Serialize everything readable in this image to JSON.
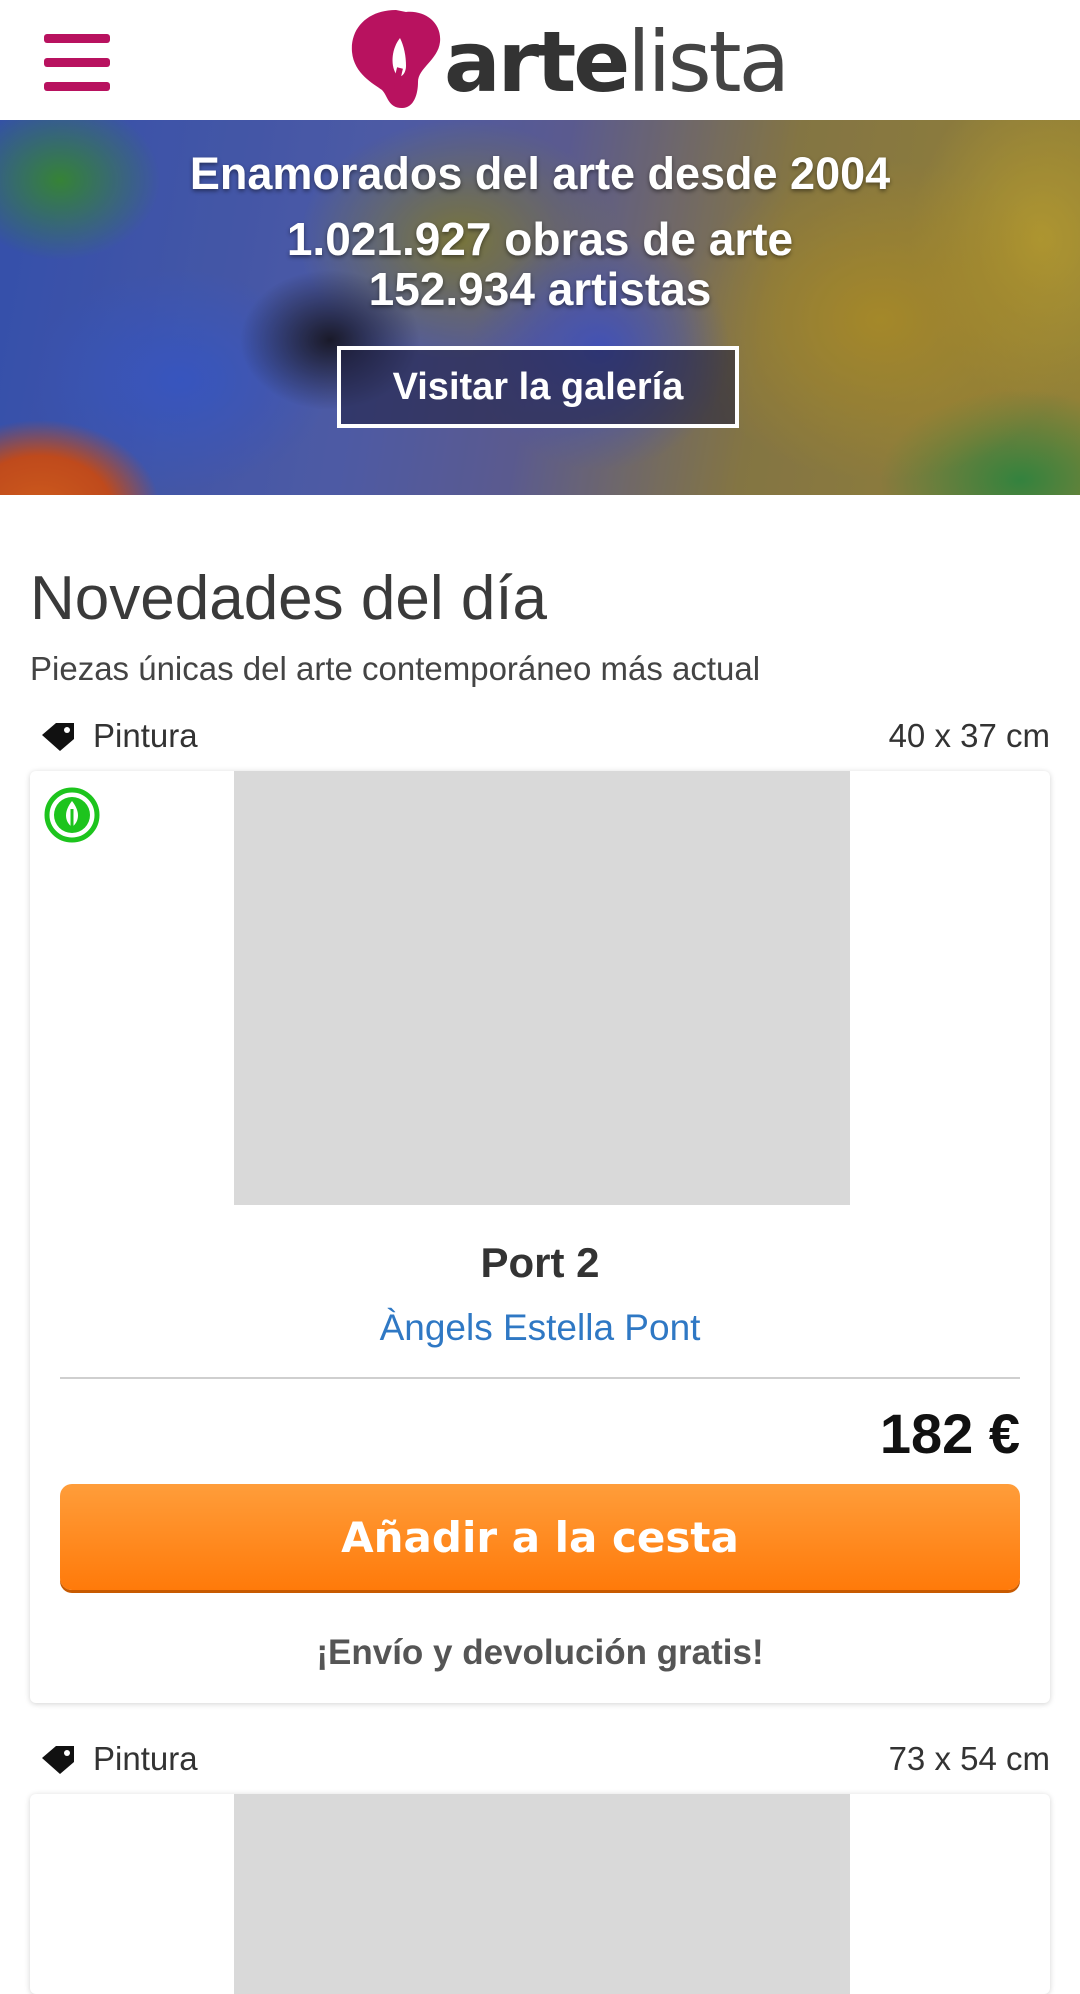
{
  "header": {
    "logo_text_bold": "arte",
    "logo_text_light": "lista",
    "logo_color": "#b8125f"
  },
  "hero": {
    "title": "Enamorados del arte desde 2004",
    "artworks": "1.021.927 obras de arte",
    "artists": "152.934 artistas",
    "button_label": "Visitar la galería"
  },
  "section": {
    "title": "Novedades del día",
    "subtitle": "Piezas únicas del arte contemporáneo más actual"
  },
  "products": [
    {
      "category": "Pintura",
      "size": "40 x 37 cm",
      "title": "Port 2",
      "artist": "Àngels Estella Pont",
      "price": "182 €",
      "add_button": "Añadir a la cesta",
      "shipping": "¡Envío y devolución gratis!",
      "eco_badge": "eco-leaf-icon"
    },
    {
      "category": "Pintura",
      "size": "73 x 54 cm"
    }
  ],
  "colors": {
    "brand": "#b8125f",
    "cta_orange": "#ff7a0a",
    "artist_link": "#2f78c4",
    "eco_green": "#1dc41d"
  }
}
